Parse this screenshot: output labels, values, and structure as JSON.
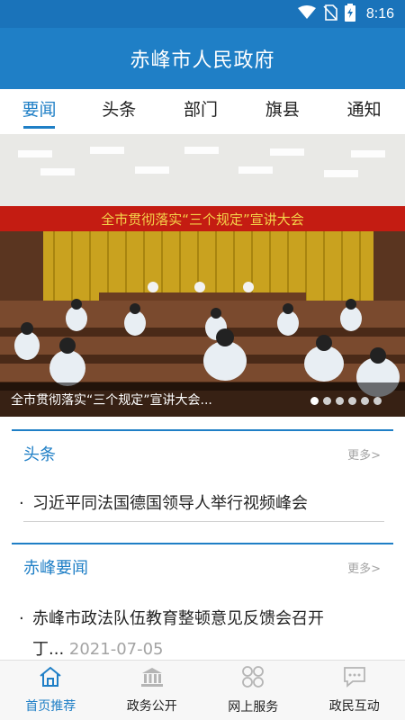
{
  "status_bar": {
    "time": "8:16",
    "icons": [
      "wifi-icon",
      "no-sim-icon",
      "battery-charging-icon"
    ]
  },
  "app_bar": {
    "title": "赤峰市人民政府"
  },
  "tabs": [
    {
      "label": "要闻",
      "active": true
    },
    {
      "label": "头条",
      "active": false
    },
    {
      "label": "部门",
      "active": false
    },
    {
      "label": "旗县",
      "active": false
    },
    {
      "label": "通知",
      "active": false
    }
  ],
  "banner": {
    "backdrop_text": "全市贯彻落实“三个规定”宣讲大会",
    "caption": "全市贯彻落实“三个规定”宣讲大会...",
    "slide_count": 6,
    "active_slide": 1
  },
  "sections": [
    {
      "title": "头条",
      "more": "更多>",
      "items": [
        {
          "title": "习近平同法国德国领导人举行视频峰会",
          "date": ""
        }
      ]
    },
    {
      "title": "赤峰要闻",
      "more": "更多>",
      "items": [
        {
          "title_line1": "赤峰市政法队伍教育整顿意见反馈会召开",
          "title_line2": "丁...",
          "date": "2021-07-05"
        }
      ]
    }
  ],
  "bottom_nav": [
    {
      "label": "首页推荐",
      "icon": "home-icon",
      "active": true
    },
    {
      "label": "政务公开",
      "icon": "government-building-icon",
      "active": false
    },
    {
      "label": "网上服务",
      "icon": "services-grid-icon",
      "active": false
    },
    {
      "label": "政民互动",
      "icon": "chat-bubble-icon",
      "active": false
    }
  ],
  "colors": {
    "primary": "#1f7fc6",
    "status_bar": "#1a73ba",
    "muted": "#a3a3a3"
  }
}
